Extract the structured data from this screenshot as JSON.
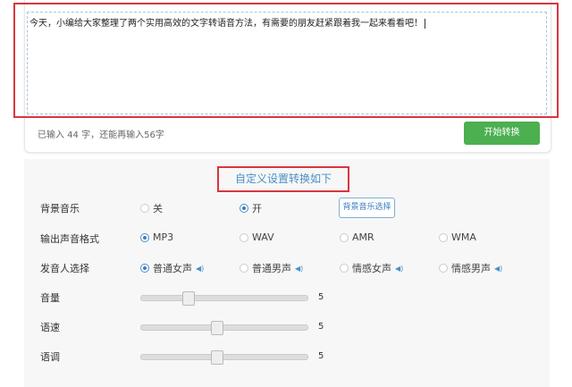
{
  "editor": {
    "text": "今天，小编给大家整理了两个实用高效的文字转语音方法，有需要的朋友赶紧跟着我一起来看看吧！",
    "count_text": "已输入 44 字，还能再输入56字",
    "start_button": "开始转换"
  },
  "settings": {
    "title": "自定义设置转换如下",
    "bg_music": {
      "label": "背景音乐",
      "options": [
        "关",
        "开"
      ],
      "selected": 1,
      "choose_button": "背景音乐选择"
    },
    "format": {
      "label": "输出声音格式",
      "options": [
        "MP3",
        "WAV",
        "AMR",
        "WMA"
      ],
      "selected": 0
    },
    "voice": {
      "label": "发音人选择",
      "options": [
        "普通女声",
        "普通男声",
        "情感女声",
        "情感男声"
      ],
      "selected": 0
    },
    "volume": {
      "label": "音量",
      "value": "5",
      "fraction": 0.28
    },
    "speed": {
      "label": "语速",
      "value": "5",
      "fraction": 0.45
    },
    "pitch": {
      "label": "语调",
      "value": "5",
      "fraction": 0.45
    }
  },
  "colors": {
    "accent": "#4a90c6",
    "button": "#4caf50",
    "highlight": "#d9363e"
  }
}
